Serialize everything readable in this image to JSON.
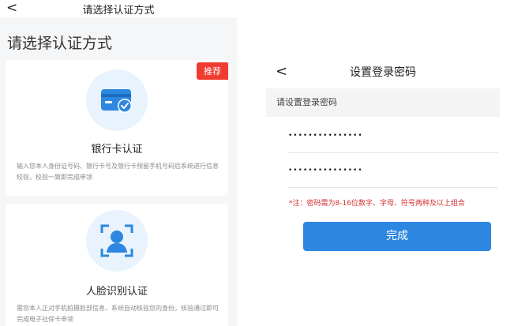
{
  "left_screen": {
    "header": {
      "back_glyph": "<",
      "title": "请选择认证方式"
    },
    "page_title": "请选择认证方式",
    "cards": [
      {
        "badge": "推荐",
        "icon": "bank-card-check-icon",
        "title": "银行卡认证",
        "description": "输入您本人身份证号码、银行卡号及银行卡预留手机号码后系统进行信息校验，校验一致即完成申领"
      },
      {
        "icon": "face-scan-icon",
        "title": "人脸识别认证",
        "description": "需您本人正对手机拍摄脸部信息，系统自动核验您的身份，核验通过即可完成电子社保卡申领"
      }
    ]
  },
  "right_screen": {
    "header": {
      "back_glyph": "<",
      "title": "设置登录密码"
    },
    "subhead": "请设置登录密码",
    "password": "•••••••••••••••",
    "confirm_password": "•••••••••••••••",
    "note": "*注：密码需为8-16位数字、字母、符号两种及以上组合",
    "done_label": "完成"
  },
  "colors": {
    "accent": "#2d87e0",
    "badge": "#ef3b30",
    "note": "#d32f2f",
    "icon_bg": "#e8f3fd"
  }
}
